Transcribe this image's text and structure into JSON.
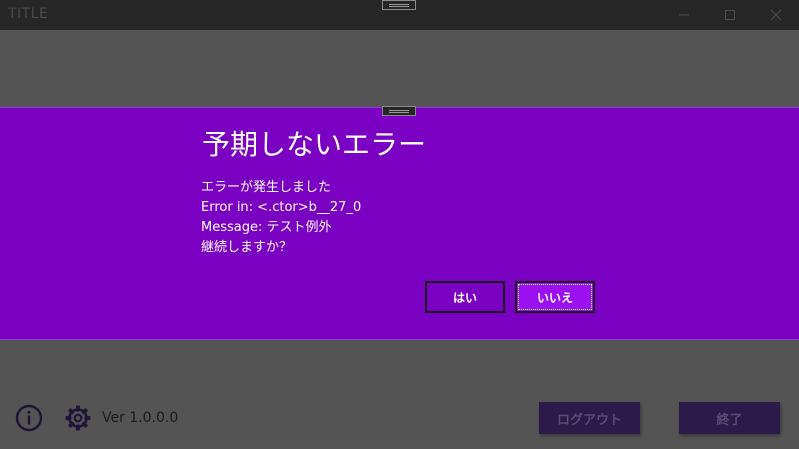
{
  "window": {
    "title": "TITLE",
    "min_icon": "minimize-icon",
    "max_icon": "maximize-icon",
    "close_icon": "close-icon"
  },
  "dialog": {
    "title": "予期しないエラー",
    "message_lines": [
      "エラーが発生しました",
      "Error in: <.ctor>b__27_0",
      "Message: テスト例外",
      "継続しますか？"
    ],
    "yes_label": "はい",
    "no_label": "いいえ"
  },
  "footer": {
    "info_icon": "info-icon",
    "settings_icon": "gear-icon",
    "version": "Ver 1.0.0.0",
    "logout_label": "ログアウト",
    "exit_label": "終了"
  },
  "colors": {
    "dialog_bg": "#7a00c2",
    "accent_button": "#9b10ef",
    "footer_button": "#2c1a4a",
    "icon": "#1e1438"
  }
}
